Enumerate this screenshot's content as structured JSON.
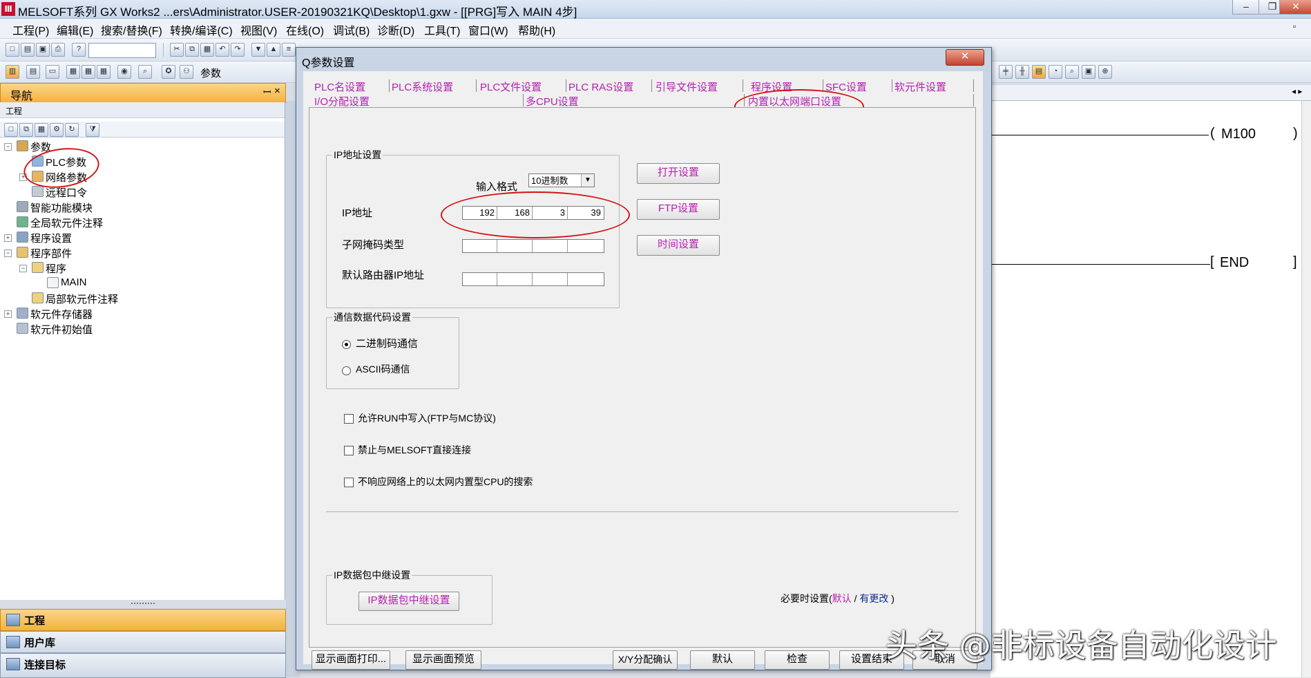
{
  "window": {
    "title": "MELSOFT系列 GX Works2 ...ers\\Administrator.USER-20190321KQ\\Desktop\\1.gxw - [[PRG]写入 MAIN 4步]",
    "icon_label": "Ⅲ"
  },
  "menu": [
    "工程(P)",
    "编辑(E)",
    "搜索/替换(F)",
    "转换/编译(C)",
    "视图(V)",
    "在线(O)",
    "调试(B)",
    "诊断(D)",
    "工具(T)",
    "窗口(W)",
    "帮助(H)"
  ],
  "toolbar": {
    "param_label": "参数"
  },
  "nav": {
    "title": "导航",
    "subtitle": "工程",
    "pin": "ꟷ",
    "close": "×",
    "tree": [
      {
        "label": "参数"
      },
      {
        "label": "PLC参数"
      },
      {
        "label": "网络参数"
      },
      {
        "label": "远程口令"
      },
      {
        "label": "智能功能模块"
      },
      {
        "label": "全局软元件注释"
      },
      {
        "label": "程序设置"
      },
      {
        "label": "程序部件"
      },
      {
        "label": "程序"
      },
      {
        "label": "MAIN"
      },
      {
        "label": "局部软元件注释"
      },
      {
        "label": "软元件存储器"
      },
      {
        "label": "软元件初始值"
      }
    ],
    "bottom": [
      "工程",
      "用户库",
      "连接目标"
    ]
  },
  "ladder": {
    "coil1": "M100",
    "end": "END"
  },
  "dialog": {
    "title": "Q参数设置",
    "close": "✕",
    "tabs_row1": [
      "PLC名设置",
      "PLC系统设置",
      "PLC文件设置",
      "PLC RAS设置",
      "引导文件设置",
      "程序设置",
      "SFC设置",
      "软元件设置"
    ],
    "tabs_row2": [
      "I/O分配设置",
      "多CPU设置",
      "内置以太网端口设置"
    ],
    "ip_group": {
      "title": "IP地址设置",
      "input_format_label": "输入格式",
      "input_format_value": "10进制数",
      "ip_label": "IP地址",
      "ip": [
        "192",
        "168",
        "3",
        "39"
      ],
      "subnet_label": "子网掩码类型",
      "gateway_label": "默认路由器IP地址"
    },
    "side_buttons": [
      "打开设置",
      "FTP设置",
      "时间设置"
    ],
    "comm_group": {
      "title": "通信数据代码设置",
      "opt_binary": "二进制码通信",
      "opt_ascii": "ASCII码通信",
      "selected": "二进制码通信"
    },
    "checks": [
      "允许RUN中写入(FTP与MC协议)",
      "禁止与MELSOFT直接连接",
      "不响应网络上的以太网内置型CPU的搜索"
    ],
    "relay_group": {
      "title": "IP数据包中继设置",
      "button": "IP数据包中继设置"
    },
    "footer_note": {
      "prefix": "必要时设置(",
      "default": "默认",
      "slash": "/",
      "changed": "有更改",
      "suffix": ")"
    },
    "bottom_buttons": [
      "显示画面打印...",
      "显示画面预览",
      "X/Y分配确认",
      "默认",
      "检查",
      "设置结束",
      "取消"
    ]
  },
  "watermark": "头条 @非标设备自动化设计",
  "colors": {
    "tab_text": "#b51fb0",
    "annotation": "#d41414",
    "nav_active": "#f2b33d"
  }
}
